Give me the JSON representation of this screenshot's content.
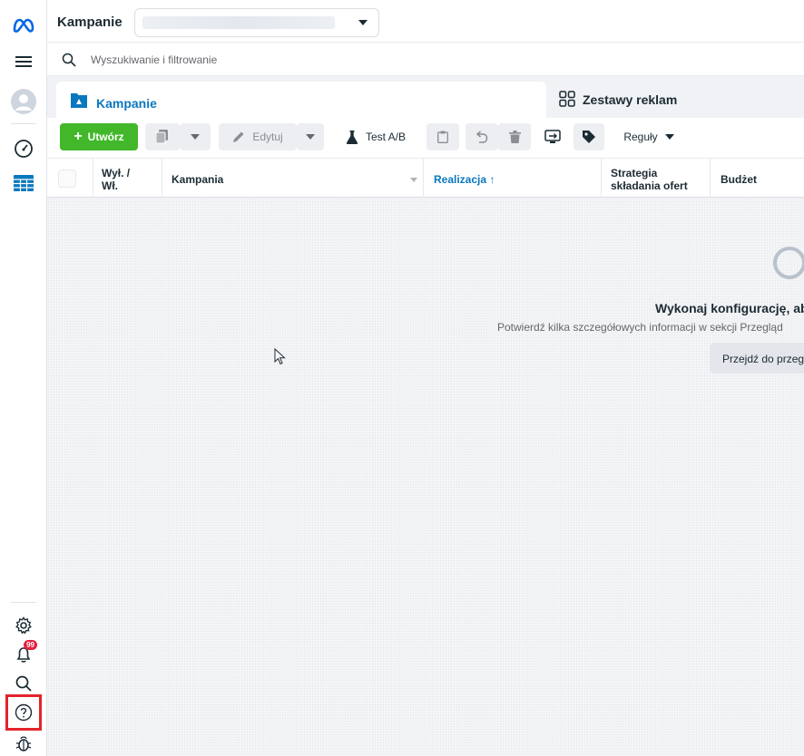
{
  "header": {
    "title": "Kampanie",
    "search_placeholder": "Wyszukiwanie i filtrowanie"
  },
  "tabs": [
    {
      "label": "Kampanie",
      "active": true
    },
    {
      "label": "Zestawy reklam",
      "active": false
    }
  ],
  "toolbar": {
    "create_label": "Utwórz",
    "edit_label": "Edytuj",
    "ab_test_label": "Test A/B",
    "rules_label": "Reguły"
  },
  "table": {
    "columns": [
      "Wył. / Wł.",
      "Kampania",
      "Realizacja ↑",
      "Strategia składania ofert",
      "Budżet"
    ],
    "col_onoff_line1": "Wył. /",
    "col_onoff_line2": "Wł.",
    "col_campaign": "Kampania",
    "col_delivery": "Realizacja",
    "col_strategy_line1": "Strategia",
    "col_strategy_line2": "składania ofert",
    "col_budget": "Budżet"
  },
  "empty_state": {
    "title": "Wykonaj konfigurację, aby",
    "description": "Potwierdź kilka szczegółowych informacji w sekcji Przegląd",
    "button_label": "Przejdź do przeg"
  },
  "rail": {
    "notification_badge": "99"
  },
  "colors": {
    "brand_blue": "#0a78be",
    "create_green": "#42b72a",
    "badge_red": "#e41e3f",
    "highlight_red": "#e3242b"
  }
}
